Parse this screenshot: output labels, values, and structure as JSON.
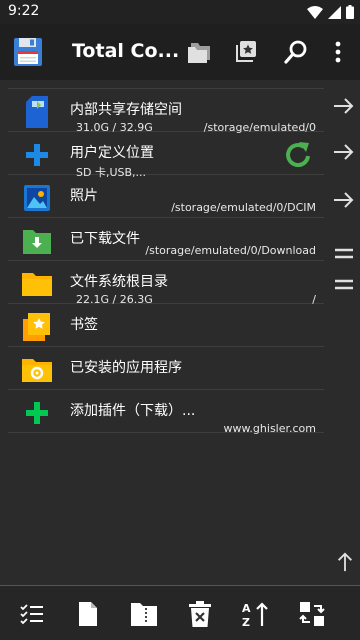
{
  "status_bar": {
    "time": "9:22"
  },
  "app": {
    "title": "Total Co..."
  },
  "toolbar": [
    "folder-tabs-icon",
    "bookmark-star-icon",
    "search-icon",
    "more-vert-icon"
  ],
  "items": [
    {
      "title": "内部共享存储空间",
      "sub": "31.0G / 32.9G",
      "path": "/storage/emulated/0",
      "icon": "sd-card-icon"
    },
    {
      "title": "用户定义位置",
      "sub": "SD 卡,USB,...",
      "path": "",
      "icon": "plus-icon",
      "extra": "refresh-icon"
    },
    {
      "title": "照片",
      "sub": "",
      "path": "/storage/emulated/0/DCIM",
      "icon": "photo-icon"
    },
    {
      "title": "已下载文件",
      "sub": "",
      "path": "/storage/emulated/0/Download",
      "icon": "download-folder-icon"
    },
    {
      "title": "文件系统根目录",
      "sub": "22.1G / 26.3G",
      "path": "/",
      "icon": "folder-icon"
    },
    {
      "title": "书签",
      "sub": "",
      "path": "",
      "icon": "bookmark-folder-icon"
    },
    {
      "title": "已安装的应用程序",
      "sub": "",
      "path": "",
      "icon": "app-folder-icon"
    },
    {
      "title": "添加插件（下载）...",
      "sub": "",
      "path": "www.ghisler.com",
      "icon": "green-plus-icon"
    }
  ],
  "bottom_bar": [
    "select-list-icon",
    "new-file-icon",
    "zip-icon",
    "delete-icon",
    "sort-az-icon",
    "swap-icon"
  ]
}
